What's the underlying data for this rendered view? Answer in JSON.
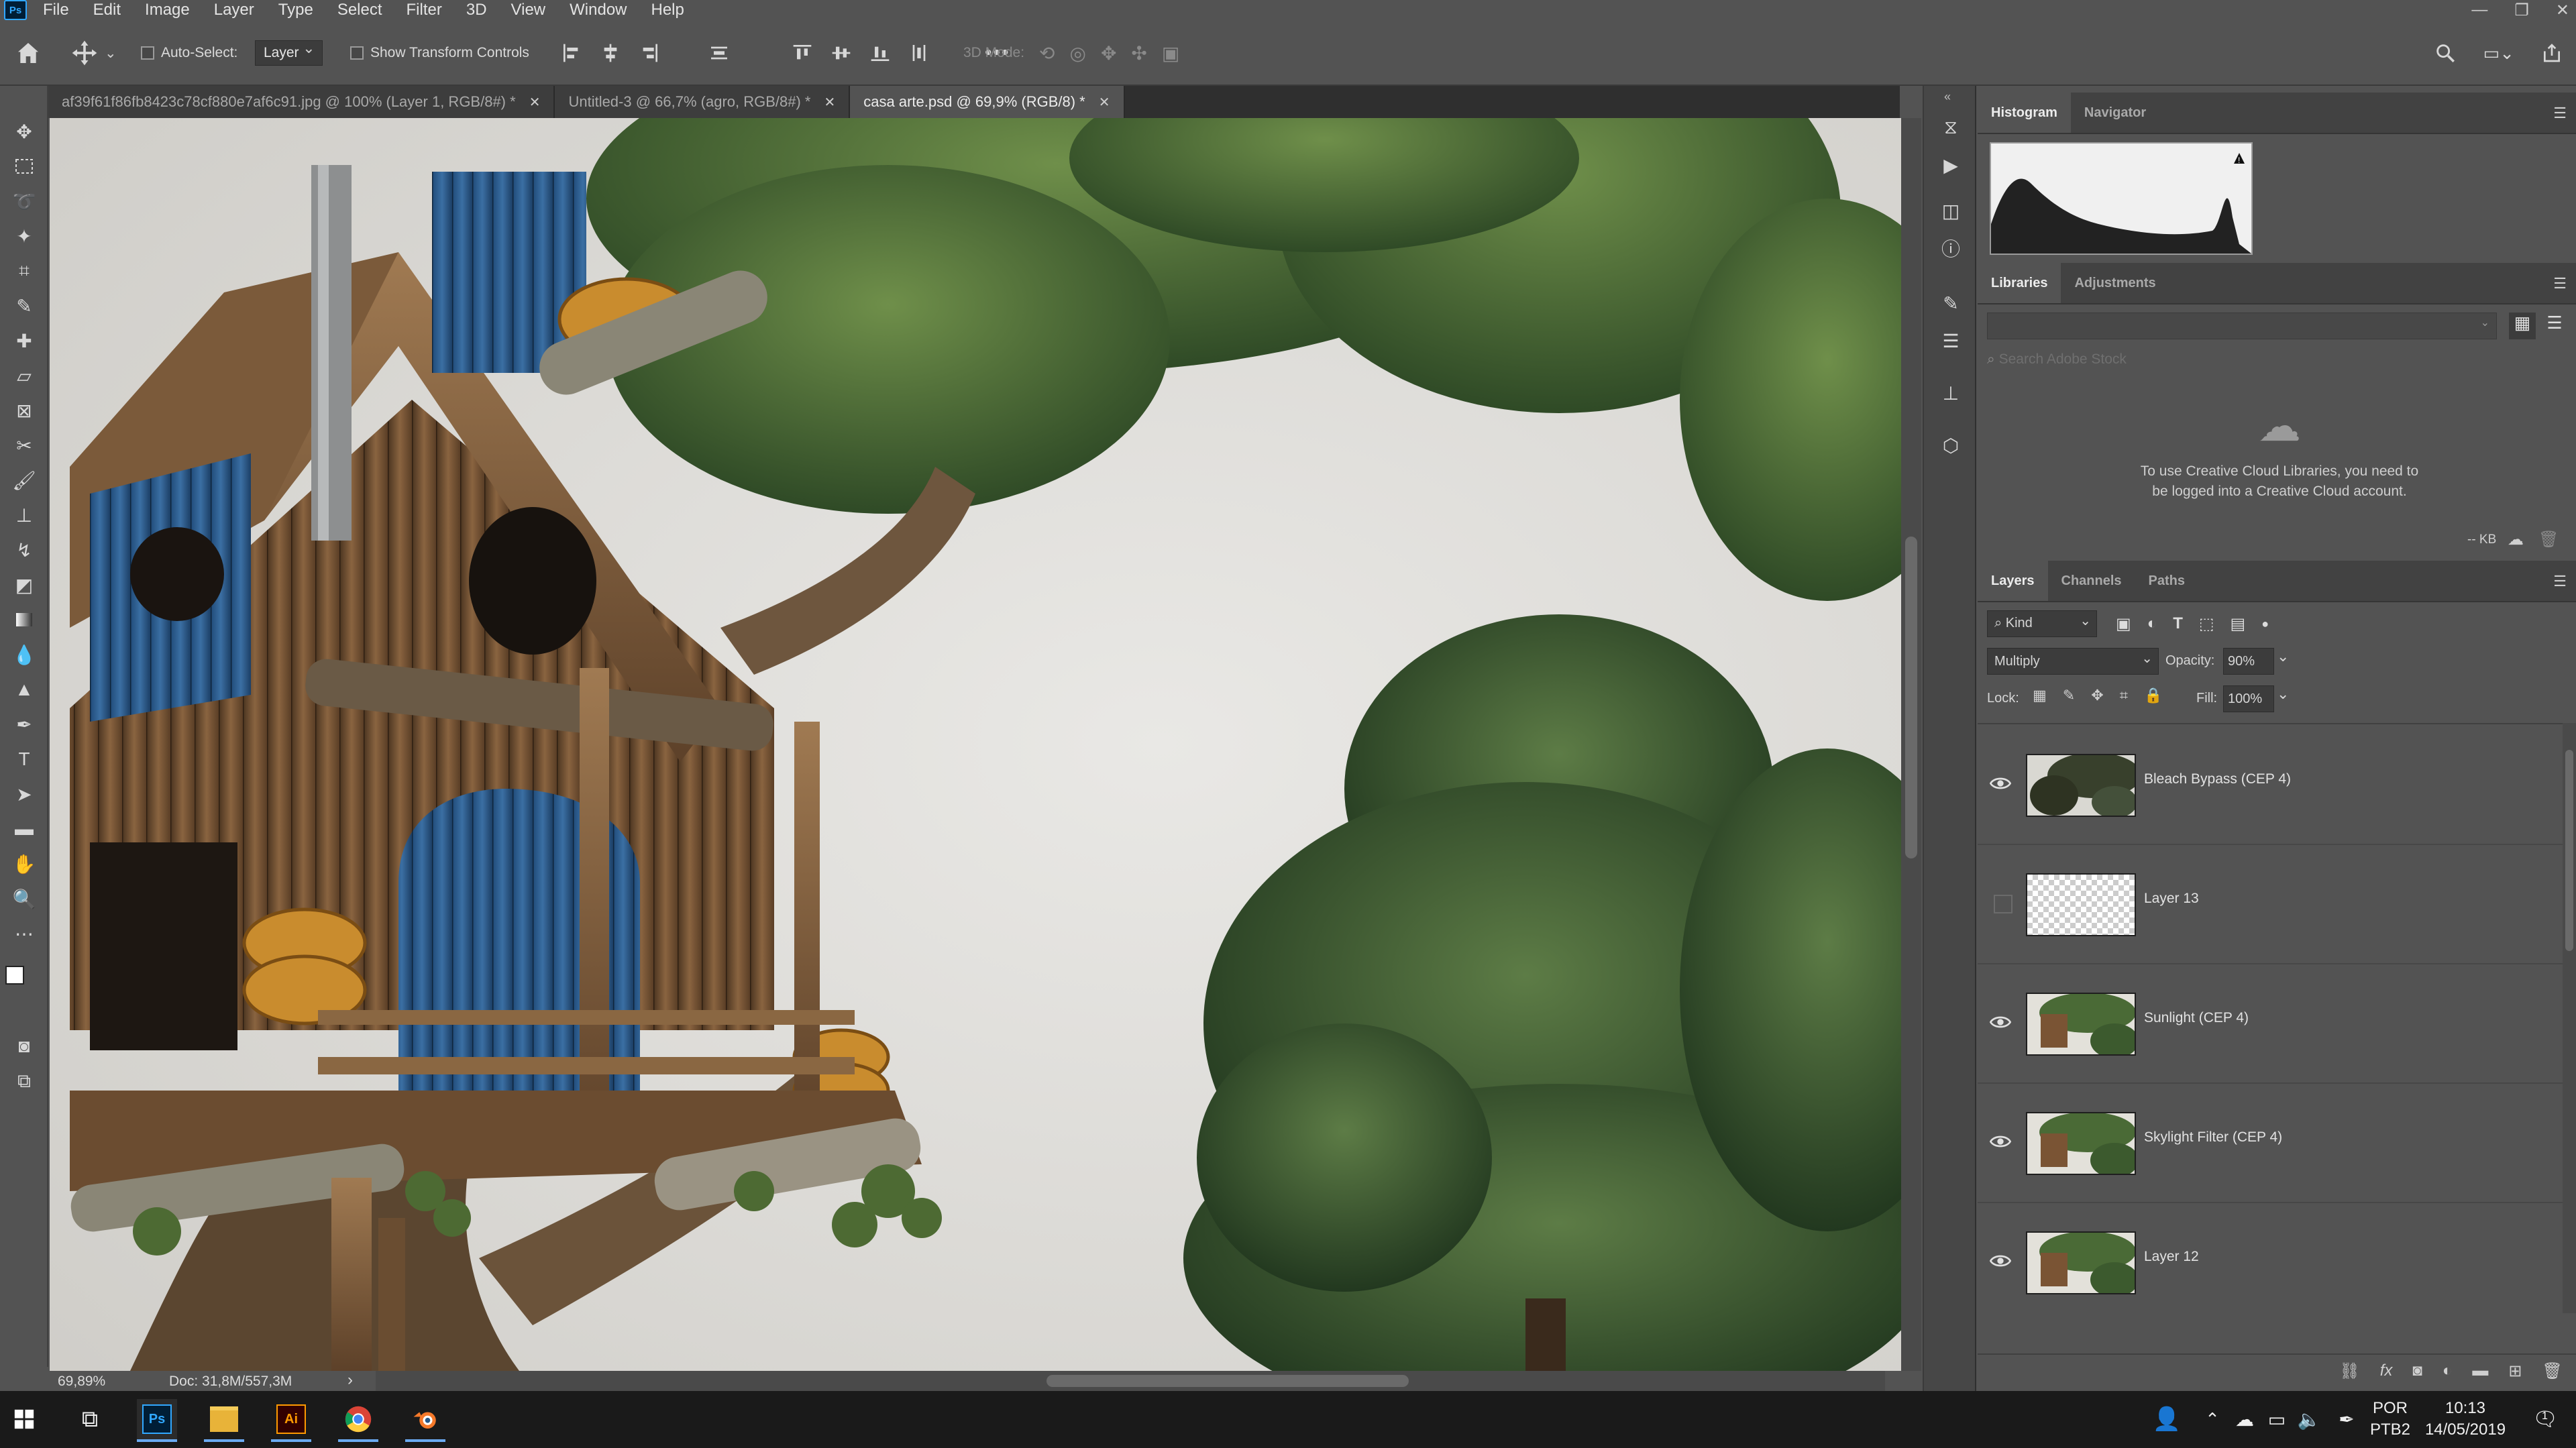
{
  "menubar": {
    "logo": "Ps",
    "items": [
      "File",
      "Edit",
      "Image",
      "Layer",
      "Type",
      "Select",
      "Filter",
      "3D",
      "View",
      "Window",
      "Help"
    ]
  },
  "options": {
    "auto_select_label": "Auto-Select:",
    "auto_select_target": "Layer",
    "show_transform_label": "Show Transform Controls",
    "three_d_mode_label": "3D Mode:"
  },
  "tabs": [
    {
      "label": "af39f61f86fb8423c78cf880e7af6c91.jpg @ 100% (Layer 1, RGB/8#) *",
      "active": false
    },
    {
      "label": "Untitled-3 @ 66,7% (agro, RGB/8#) *",
      "active": false
    },
    {
      "label": "casa arte.psd @ 69,9% (RGB/8) *",
      "active": true
    }
  ],
  "status": {
    "zoom": "69,89%",
    "doc": "Doc: 31,8M/557,3M"
  },
  "panels": {
    "histogram_tabs": [
      "Histogram",
      "Navigator"
    ],
    "libraries_tabs": [
      "Libraries",
      "Adjustments"
    ],
    "libraries_search_placeholder": "Search Adobe Stock",
    "libraries_message": "To use Creative Cloud Libraries, you need to be logged into a Creative Cloud account.",
    "libraries_size": "-- KB",
    "layers_tabs": [
      "Layers",
      "Channels",
      "Paths"
    ],
    "filter_kind": "Kind",
    "blend_mode": "Multiply",
    "opacity_label": "Opacity:",
    "opacity_value": "90%",
    "lock_label": "Lock:",
    "fill_label": "Fill:",
    "fill_value": "100%",
    "layers": [
      {
        "name": "Bleach Bypass (CEP 4)",
        "visible": true
      },
      {
        "name": "Layer 13",
        "visible": false
      },
      {
        "name": "Sunlight (CEP 4)",
        "visible": true
      },
      {
        "name": "Skylight Filter (CEP 4)",
        "visible": true
      },
      {
        "name": "Layer 12",
        "visible": true
      }
    ]
  },
  "taskbar": {
    "lang_top": "POR",
    "lang_bottom": "PTB2",
    "time": "10:13",
    "date": "14/05/2019",
    "notifications": "1"
  }
}
